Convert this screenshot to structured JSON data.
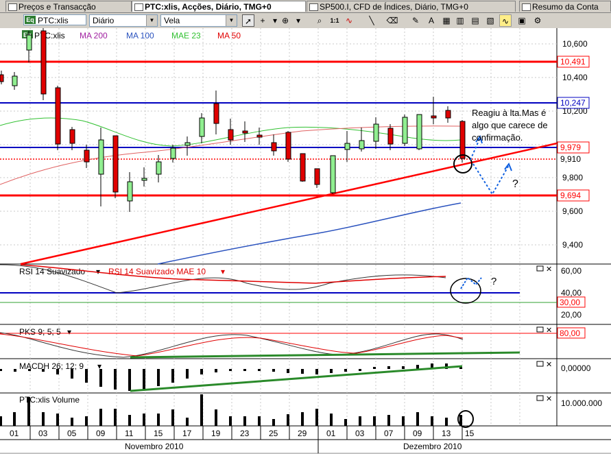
{
  "tabs": [
    {
      "label": "Preços e Transacção",
      "active": false
    },
    {
      "label": "PTC:xlis, Acções, Diário, TMG+0",
      "active": true
    },
    {
      "label": "SP500.I, CFD de Índices, Diário, TMG+0",
      "active": false
    },
    {
      "label": "Resumo da Conta",
      "active": false
    }
  ],
  "toolbar": {
    "symbol": "PTC:xlis",
    "symbol_badge": "Eq",
    "period": "Diário",
    "chart_style": "Vela",
    "buttons": [
      "cursor",
      "crosshair",
      "zoom",
      "scale-1-1",
      "indicator",
      "line",
      "eraser",
      "draw",
      "bar-chart",
      "candle",
      "highlight"
    ]
  },
  "main_panel": {
    "legend": [
      {
        "label": "PTC:xlis",
        "color": "#000000"
      },
      {
        "label": "MA 200",
        "color": "#a020a0"
      },
      {
        "label": "MA 100",
        "color": "#2a52be"
      },
      {
        "label": "MAE 23",
        "color": "#30c030"
      },
      {
        "label": "MA 50",
        "color": "#e00000"
      }
    ],
    "axis_ticks": [
      "10,600",
      "10,400",
      "10,200",
      "9,800",
      "9,600",
      "9,400"
    ],
    "levels": [
      {
        "value": "10,491",
        "color": "#ff0000"
      },
      {
        "value": "10,247",
        "color": "#0000c0"
      },
      {
        "value": "9,979",
        "color": "#0000c0"
      },
      {
        "value": "9,910",
        "color": "#ff0000"
      },
      {
        "value": "9,694",
        "color": "#ff0000"
      }
    ],
    "annotation_lines": [
      "Reagiu à lta.Mas é",
      "algo que carece de",
      "confirmação."
    ],
    "question_mark": "?"
  },
  "rsi_panel": {
    "legend": [
      {
        "label": "RSI 14 Suavizado",
        "color": "#000000"
      },
      {
        "label": "RSI 14 Suavizado MAE 10",
        "color": "#e00000"
      }
    ],
    "axis_ticks": [
      "60,00",
      "40,00",
      "20,00"
    ],
    "level_label": "30,00",
    "question_mark": "?"
  },
  "pks_panel": {
    "legend": [
      {
        "label": "PKS 9; 5; 5",
        "color": "#000000"
      }
    ],
    "level_label": "80,00"
  },
  "macd_panel": {
    "legend": [
      {
        "label": "MACDH 26; 12; 9",
        "color": "#000000"
      }
    ],
    "axis_ticks": [
      "0,00000"
    ]
  },
  "volume_panel": {
    "legend": [
      {
        "label": "PTC:xlis Volume",
        "color": "#000000"
      }
    ],
    "axis_ticks": [
      "10.000.000"
    ]
  },
  "date_axis": {
    "days": [
      "01",
      "03",
      "05",
      "09",
      "11",
      "15",
      "17",
      "19",
      "23",
      "25",
      "29",
      "01",
      "03",
      "07",
      "09",
      "13",
      "15"
    ],
    "months": [
      "Novembro 2010",
      "Dezembro 2010"
    ]
  },
  "colors": {
    "up_candle": "#90ee90",
    "down_candle": "#e00000",
    "support": "#ff0000",
    "resistance": "#0000c0"
  }
}
